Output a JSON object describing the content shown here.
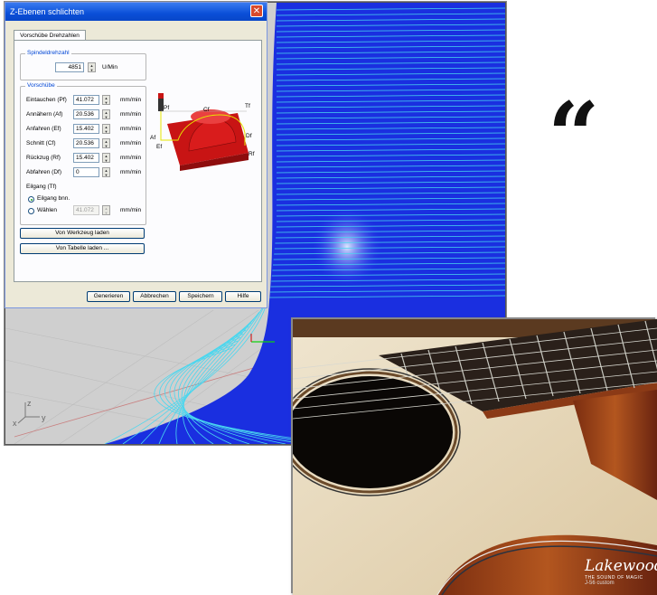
{
  "dialog": {
    "title": "Z-Ebenen schlichten",
    "close_symbol": "✕",
    "tab_label": "Vorschübe Drehzahlen",
    "spindle": {
      "group_label": "Spindeldrehzahl",
      "value": "4851",
      "unit": "U/Min"
    },
    "feeds": {
      "group_label": "Vorschübe",
      "rows": [
        {
          "label": "Eintauchen (Pf)",
          "value": "41.072",
          "unit": "mm/min"
        },
        {
          "label": "Annähern (Af)",
          "value": "20.536",
          "unit": "mm/min"
        },
        {
          "label": "Anfahren (Ef)",
          "value": "15.402",
          "unit": "mm/min"
        },
        {
          "label": "Schnitt (Cf)",
          "value": "20.536",
          "unit": "mm/min"
        },
        {
          "label": "Rückzug (Rf)",
          "value": "15.402",
          "unit": "mm/min"
        },
        {
          "label": "Abfahren (Df)",
          "value": "0",
          "unit": "mm/min"
        }
      ],
      "rapid_label": "Eilgang (Tf)",
      "rapid_options": [
        {
          "label": "Eilgang bnn.",
          "selected": true
        },
        {
          "label": "Wählen",
          "selected": false
        }
      ],
      "rapid_value": "41.072",
      "rapid_unit": "mm/min"
    },
    "diagram_labels": [
      "Pf",
      "Cf",
      "Tf",
      "Af",
      "Ef",
      "Df",
      "Rf"
    ],
    "load_buttons": [
      "Von Werkzeug laden",
      "Von Tabelle laden ..."
    ],
    "footer_buttons": [
      "Generieren",
      "Abbrechen",
      "Speichern",
      "Hilfe"
    ]
  },
  "viewport": {
    "axis_labels": {
      "z": "z",
      "x": "x",
      "y": "y"
    }
  },
  "quote_mark": "“",
  "photo": {
    "brand": "Lakewood",
    "tagline": "THE SOUND OF MAGIC",
    "model": "J-56 custom"
  }
}
